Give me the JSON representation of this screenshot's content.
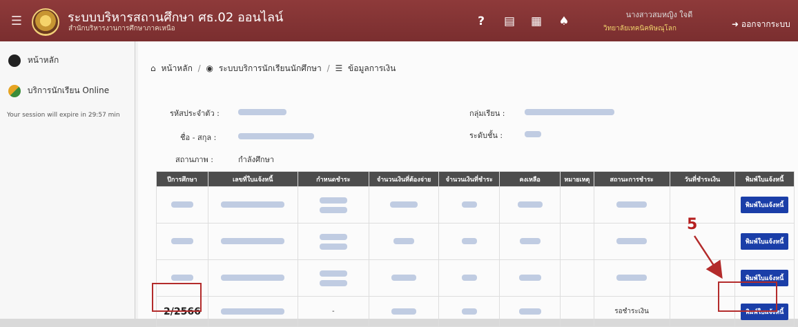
{
  "header": {
    "title": "ระบบบริหารสถานศึกษา ศธ.02 ออนไลน์",
    "subtitle": "สำนักบริหารงานการศึกษาภาคเหนือ",
    "user_name": "นางสาวสมหญิง ใจดี",
    "user_school": "วิทยาลัยเทคนิคพิษณุโลก",
    "logout_label": "ออกจากระบบ"
  },
  "sidebar": {
    "items": [
      {
        "label": "หน้าหลัก"
      },
      {
        "label": "บริการนักเรียน Online"
      }
    ],
    "session_text": "Your session will expire in 29:57 min"
  },
  "breadcrumb": {
    "home": "หน้าหลัก",
    "service": "ระบบบริการนักเรียนนักศึกษา",
    "current": "ข้อมูลการเงิน"
  },
  "student": {
    "id_label": "รหัสประจำตัว :",
    "name_label": "ชื่อ - สกุล :",
    "status_label": "สถานภาพ :",
    "status_value": "กำลังศึกษา",
    "group_label": "กลุ่มเรียน :",
    "level_label": "ระดับชั้น :"
  },
  "table": {
    "headers": [
      "ปีการศึกษา",
      "เลขที่ใบแจ้งหนี้",
      "กำหนดชำระ",
      "จำนวนเงินที่ต้องจ่าย",
      "จำนวนเงินที่ชำระ",
      "คงเหลือ",
      "หมายเหตุ",
      "สถานะการชำระ",
      "วันที่ชำระเงิน",
      "พิมพ์ใบแจ้งหนี้"
    ],
    "rows": [
      {
        "term": "",
        "status": "",
        "print": "พิมพ์ใบแจ้งหนี้"
      },
      {
        "term": "",
        "status": "",
        "print": "พิมพ์ใบแจ้งหนี้"
      },
      {
        "term": "",
        "status": "",
        "print": "พิมพ์ใบแจ้งหนี้"
      },
      {
        "term": "2/2566",
        "status": "รอชำระเงิน",
        "print": "พิมพ์ใบแจ้งหนี้"
      }
    ]
  },
  "annotation": "5",
  "colors": {
    "header": "#7a2e2f",
    "button": "#1a3ea8",
    "mark": "#b32b2b"
  },
  "icons": [
    "menu-icon",
    "help-icon",
    "notes-icon",
    "calendar-icon",
    "bell-icon",
    "logout-icon",
    "home-icon",
    "services-icon",
    "list-icon"
  ]
}
